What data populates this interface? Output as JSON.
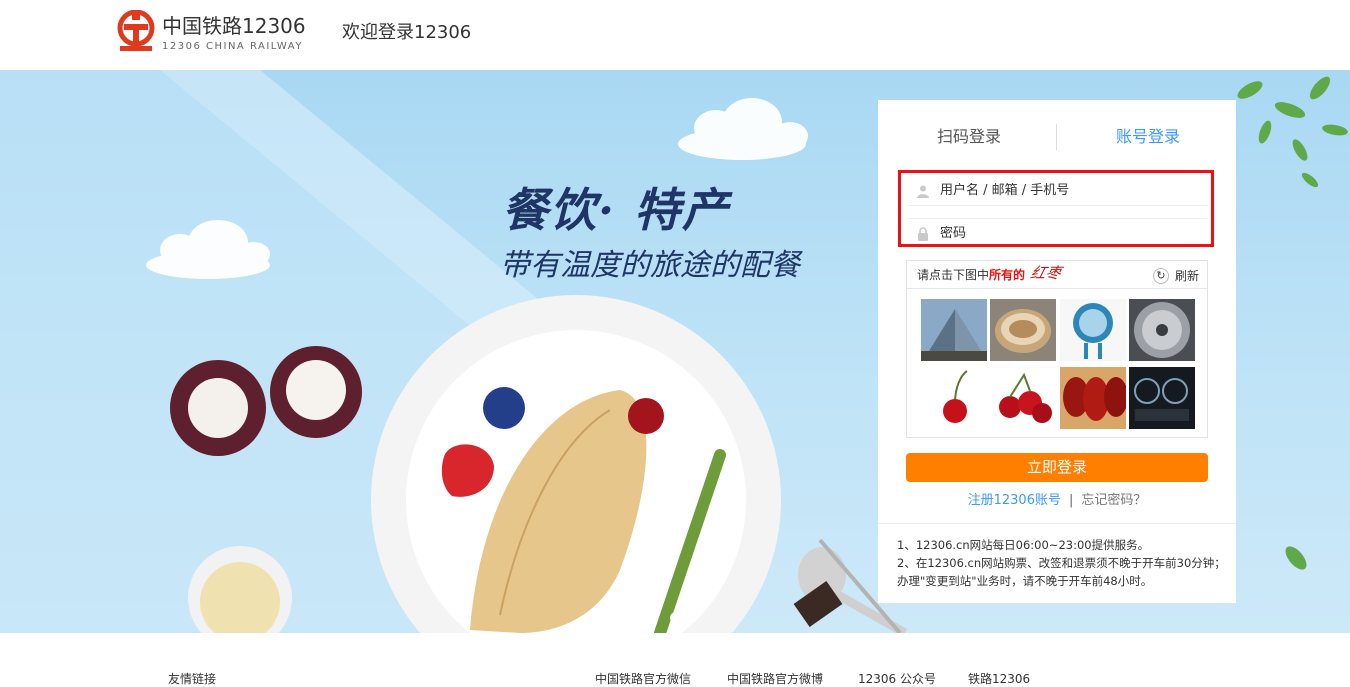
{
  "header": {
    "brand_cn": "中国铁路12306",
    "brand_en": "12306 CHINA RAILWAY",
    "welcome": "欢迎登录12306"
  },
  "banner": {
    "headline": "餐饮· 特产",
    "subline": "带有温度的旅途的配餐"
  },
  "login": {
    "tab_qr": "扫码登录",
    "tab_account": "账号登录",
    "username_placeholder": "用户名 / 邮箱 / 手机号",
    "password_placeholder": "密码",
    "captcha": {
      "prompt_prefix": "请点击下图中",
      "prompt_highlight": "所有的",
      "target_word": "红枣",
      "refresh": "刷新",
      "images": [
        "pyramid",
        "steamer",
        "electric-fan",
        "fan-grille",
        "cherry",
        "cherries",
        "red-dates",
        "dashboard"
      ]
    },
    "submit": "立即登录",
    "register": "注册12306账号",
    "separator": "|",
    "forgot": "忘记密码？",
    "notice_1": "1、12306.cn网站每日06:00~23:00提供服务。",
    "notice_2": "2、在12306.cn网站购票、改签和退票须不晚于开车前30分钟；办理\"变更到站\"业务时，请不晚于开车前48小时。"
  },
  "footer": {
    "friend_links": "友情链接",
    "wechat": "中国铁路官方微信",
    "weibo": "中国铁路官方微博",
    "public_account": "12306 公众号",
    "app": "铁路12306"
  },
  "colors": {
    "accent": "#3b99fc",
    "button": "#ff8000",
    "highlight_border": "#e11111"
  }
}
